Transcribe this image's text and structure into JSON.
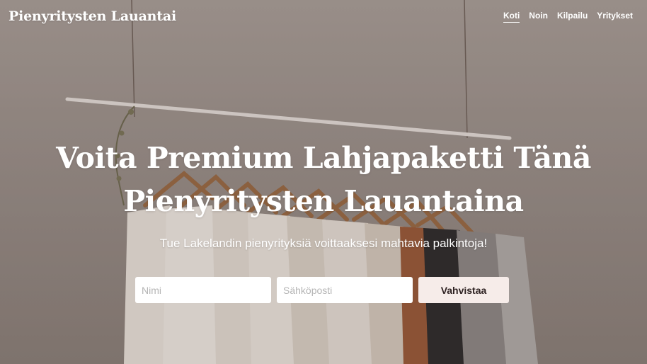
{
  "brand": {
    "title": "Pienyritysten Lauantai"
  },
  "nav": {
    "items": [
      {
        "label": "Koti",
        "active": true
      },
      {
        "label": "Noin",
        "active": false
      },
      {
        "label": "Kilpailu",
        "active": false
      },
      {
        "label": "Yritykset",
        "active": false
      }
    ]
  },
  "hero": {
    "headline_line1": "Voita Premium Lahjapaketti Tänä",
    "headline_line2": "Pienyritysten Lauantaina",
    "subline": "Tue Lakelandin pienyrityksiä voittaaksesi mahtavia palkintoja!"
  },
  "form": {
    "name_placeholder": "Nimi",
    "email_placeholder": "Sähköposti",
    "submit_label": "Vahvistaa"
  },
  "colors": {
    "background": "#b7aca6",
    "text": "#ffffff",
    "button_bg": "#f6ece9",
    "button_text": "#2e2222"
  },
  "background_image": "clothing-rack-photo"
}
